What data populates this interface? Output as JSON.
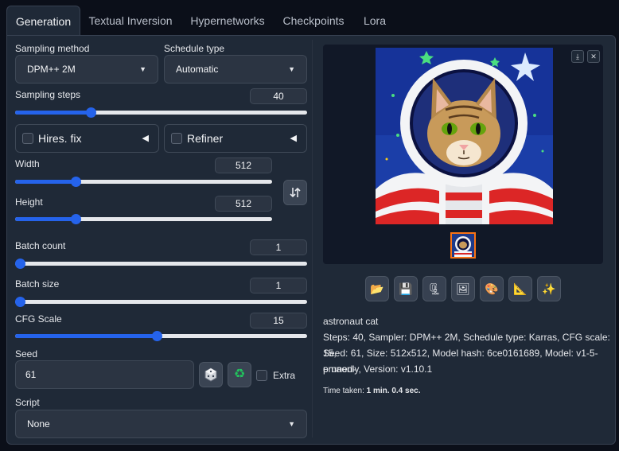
{
  "tabs": [
    {
      "label": "Generation",
      "active": true
    },
    {
      "label": "Textual Inversion",
      "active": false
    },
    {
      "label": "Hypernetworks",
      "active": false
    },
    {
      "label": "Checkpoints",
      "active": false
    },
    {
      "label": "Lora",
      "active": false
    }
  ],
  "sampling": {
    "method_label": "Sampling method",
    "method_value": "DPM++ 2M",
    "schedule_label": "Schedule type",
    "schedule_value": "Automatic",
    "steps_label": "Sampling steps",
    "steps_value": "40",
    "steps_fraction": 0.26
  },
  "hires": {
    "label": "Hires. fix",
    "checked": false
  },
  "refiner": {
    "label": "Refiner",
    "checked": false
  },
  "width": {
    "label": "Width",
    "value": "512",
    "fraction": 0.235
  },
  "height": {
    "label": "Height",
    "value": "512",
    "fraction": 0.235
  },
  "batch_count": {
    "label": "Batch count",
    "value": "1",
    "fraction": 0.0
  },
  "batch_size": {
    "label": "Batch size",
    "value": "1",
    "fraction": 0.0
  },
  "cfg": {
    "label": "CFG Scale",
    "value": "15",
    "fraction": 0.485
  },
  "seed": {
    "label": "Seed",
    "value": "61",
    "extra_label": "Extra",
    "extra_checked": false
  },
  "script": {
    "label": "Script",
    "value": "None"
  },
  "output": {
    "prompt": "astronaut cat",
    "params_line1": "Steps: 40, Sampler: DPM++ 2M, Schedule type: Karras, CFG scale: 15,",
    "params_line2": "Seed: 61, Size: 512x512, Model hash: 6ce0161689, Model: v1-5-pruned-",
    "params_line3": "emaonly, Version: v1.10.1",
    "time_prefix": "Time taken: ",
    "time_value": "1 min. 0.4 sec."
  },
  "icons": {
    "swap": "swap-dimensions-icon",
    "dice": "dice-icon",
    "recycle": "recycle-icon",
    "download": "download-icon",
    "close": "close-icon",
    "actions": [
      "folder-icon",
      "save-icon",
      "zip-icon",
      "image-icon",
      "palette-icon",
      "ruler-icon",
      "sparkle-icon"
    ]
  },
  "colors": {
    "accent": "#2563eb",
    "background": "#0b0f19",
    "panel": "#1f2937",
    "thumbnail_border": "#f97316"
  }
}
